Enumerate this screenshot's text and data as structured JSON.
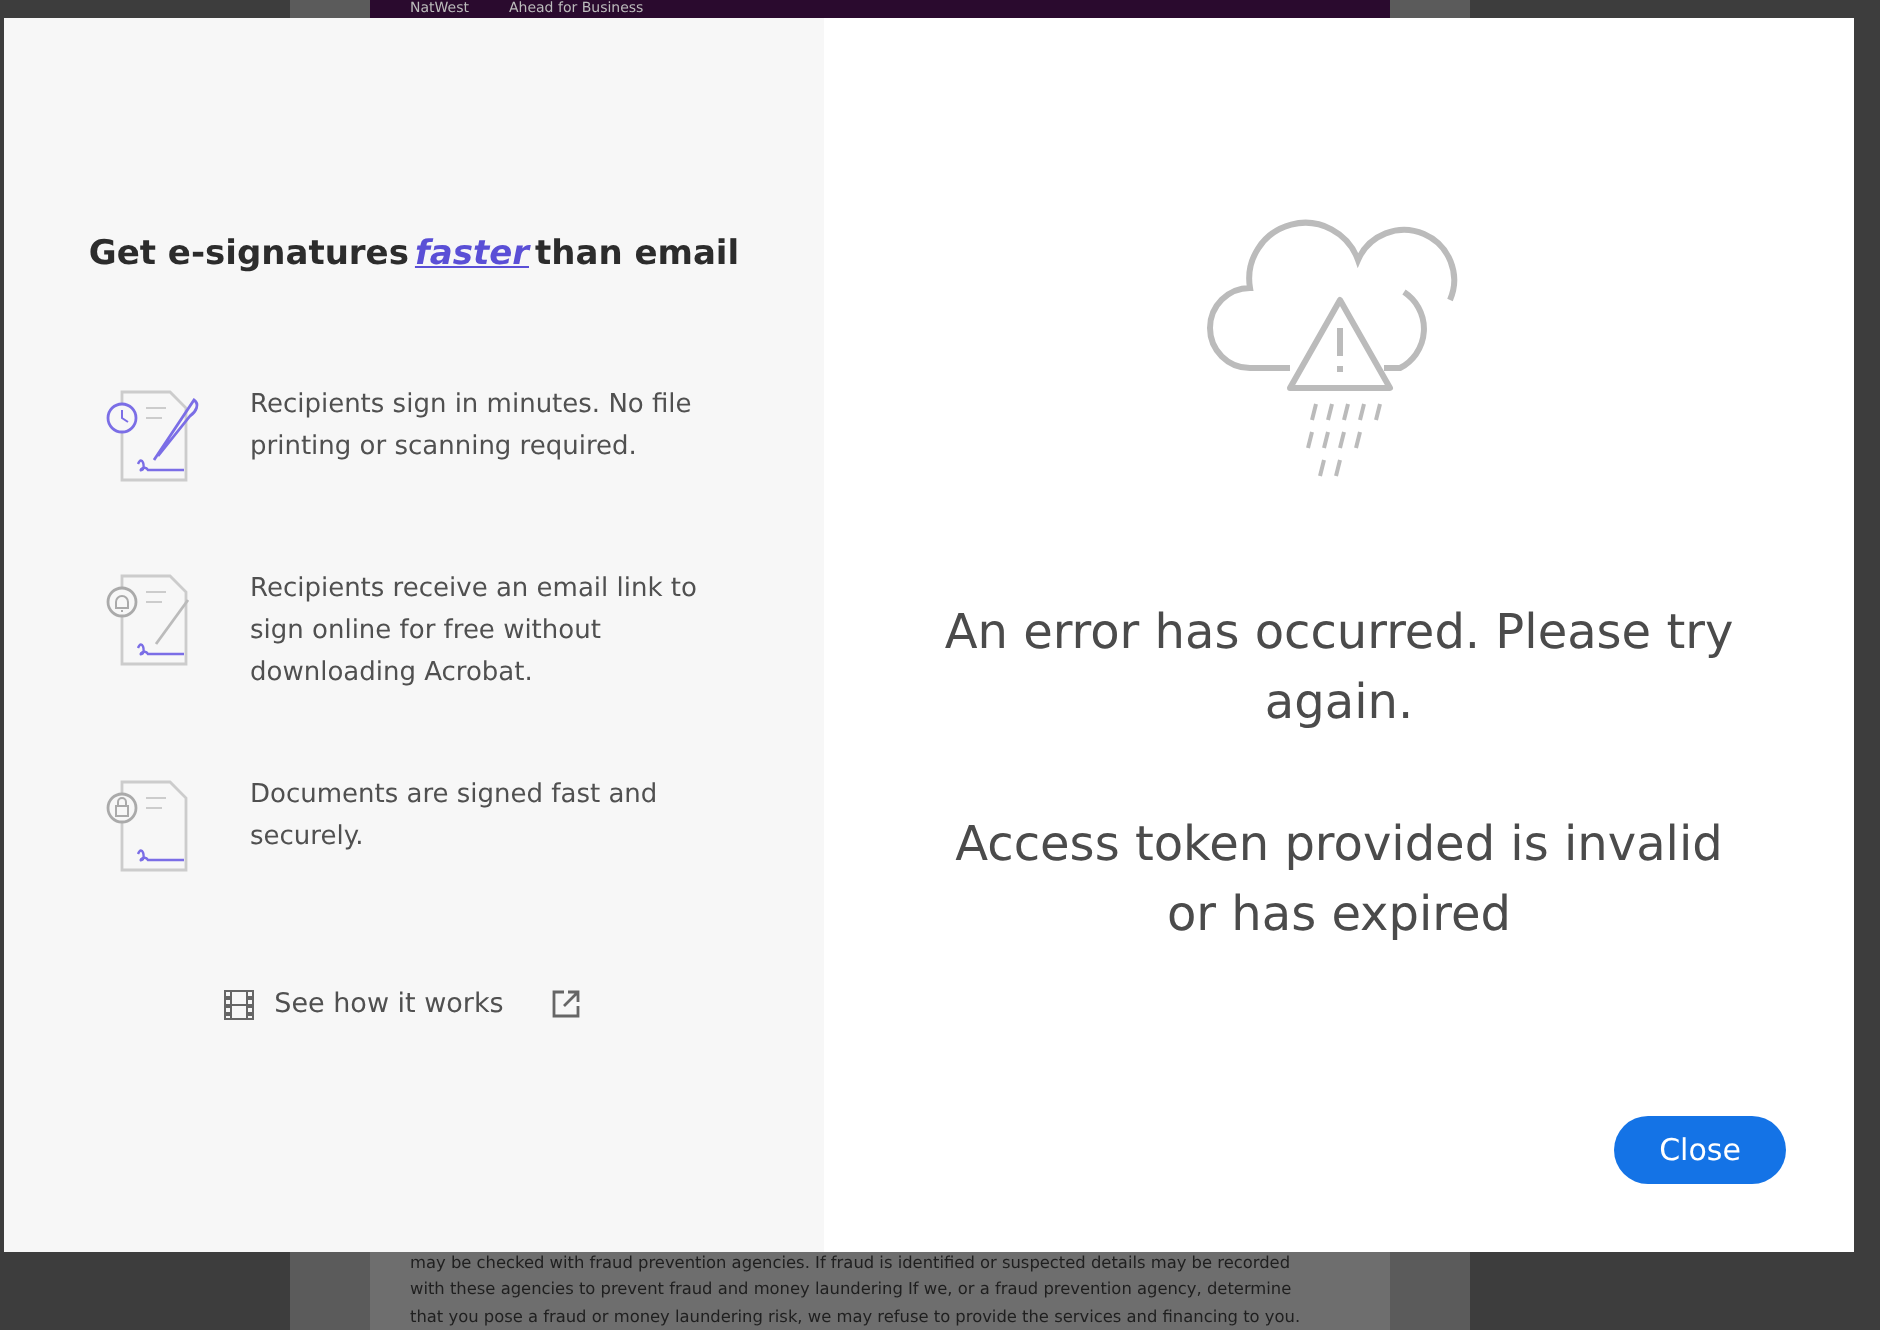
{
  "background_document": {
    "banner": {
      "brand": "NatWest",
      "tagline": "Ahead for Business"
    },
    "lines": [
      "may be checked with fraud prevention agencies. If fraud is identified or suspected details may be recorded",
      "with these agencies to prevent fraud and money laundering If we, or a fraud prevention agency, determine",
      "that you pose a fraud or money laundering risk, we may refuse to provide the services and financing to you."
    ]
  },
  "promo": {
    "heading": {
      "before": "Get e-signatures",
      "highlight": "faster",
      "after": "than email"
    },
    "features": [
      {
        "kind": "pen",
        "text": "Recipients sign in minutes. No file printing or scanning required."
      },
      {
        "kind": "bell",
        "text": "Recipients receive an email link to sign online for free without downloading Acrobat."
      },
      {
        "kind": "lock",
        "text": "Documents are signed fast and securely."
      }
    ],
    "video_link": "See how it works"
  },
  "error": {
    "message": "An error has occurred. Please try again.",
    "detail": "Access token provided is invalid or has expired"
  },
  "close_button": "Close"
}
